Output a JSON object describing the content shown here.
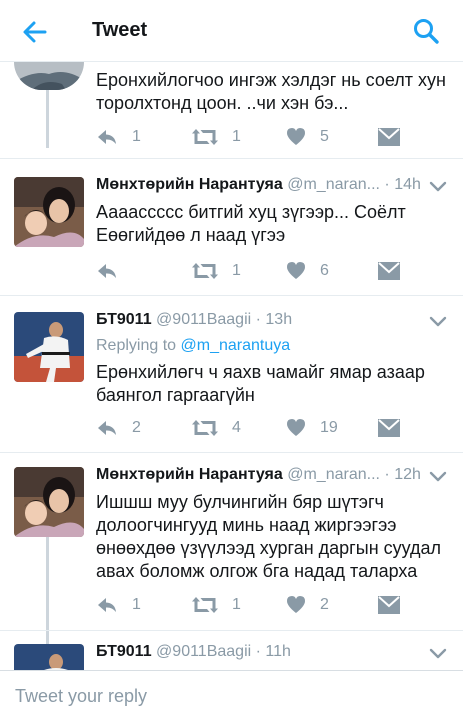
{
  "header": {
    "title": "Tweet",
    "back_icon": "back-arrow-icon",
    "search_icon": "search-icon",
    "accent": "#1da1f2"
  },
  "tweets": [
    {
      "text_lines": [
        "Еронхийлогчоо ингэж хэлдэг нь соелт хун",
        "торолхтонд цоон. ..чи хэн бэ..."
      ],
      "replies": "1",
      "retweets": "1",
      "likes": "5"
    },
    {
      "name": "Мөнхтөрийн Нарантуяа",
      "handle": "@m_naran...",
      "time": "14h",
      "text_lines": [
        "Аааассссс битгий хуц зүгээр... Соёлт",
        "Еөөгийдөө л наад үгээ"
      ],
      "replies": "",
      "retweets": "1",
      "likes": "6"
    },
    {
      "name": "БТ9011",
      "handle": "@9011Baagii",
      "time": "13h",
      "replying_prefix": "Replying to",
      "replying_to": "@m_narantuya",
      "text_lines": [
        "Ерөнхийлөгч ч яахв чамайг ямар азаар",
        "баянгол гаргаагүйн"
      ],
      "replies": "2",
      "retweets": "4",
      "likes": "19"
    },
    {
      "name": "Мөнхтөрийн Нарантуяа",
      "handle": "@m_naran...",
      "time": "12h",
      "text_lines": [
        "Ишшш муу булчингийн бяр шүтэгч",
        "долоогчингууд минь наад жиргээгээ",
        "өнөөхдөө үзүүлээд хурган даргын суудал",
        "авах боломж олгож бга надад таларха"
      ],
      "replies": "1",
      "retweets": "1",
      "likes": "2"
    },
    {
      "name": "БТ9011",
      "handle": "@9011Baagii",
      "time": "11h"
    }
  ],
  "reply": {
    "placeholder": "Tweet your reply"
  }
}
